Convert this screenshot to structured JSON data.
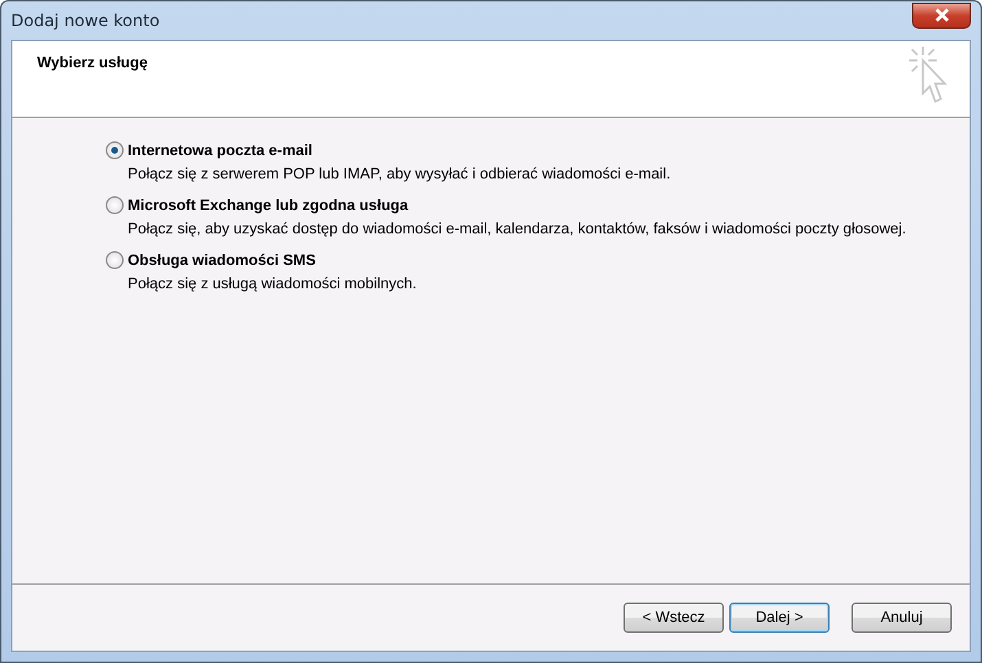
{
  "window": {
    "title": "Dodaj nowe konto"
  },
  "header": {
    "title": "Wybierz usługę"
  },
  "options": [
    {
      "label": "Internetowa poczta e-mail",
      "description": "Połącz się z serwerem POP lub IMAP, aby wysyłać i odbierać wiadomości e-mail.",
      "selected": true
    },
    {
      "label": "Microsoft Exchange lub zgodna usługa",
      "description": "Połącz się, aby uzyskać dostęp do wiadomości e-mail, kalendarza, kontaktów, faksów i wiadomości poczty głosowej.",
      "selected": false
    },
    {
      "label": "Obsługa wiadomości SMS",
      "description": "Połącz się z usługą wiadomości mobilnych.",
      "selected": false
    }
  ],
  "buttons": [
    {
      "label": "< Wstecz",
      "default": false
    },
    {
      "label": "Dalej >",
      "default": true
    },
    {
      "label": "Anuluj",
      "default": false
    }
  ]
}
